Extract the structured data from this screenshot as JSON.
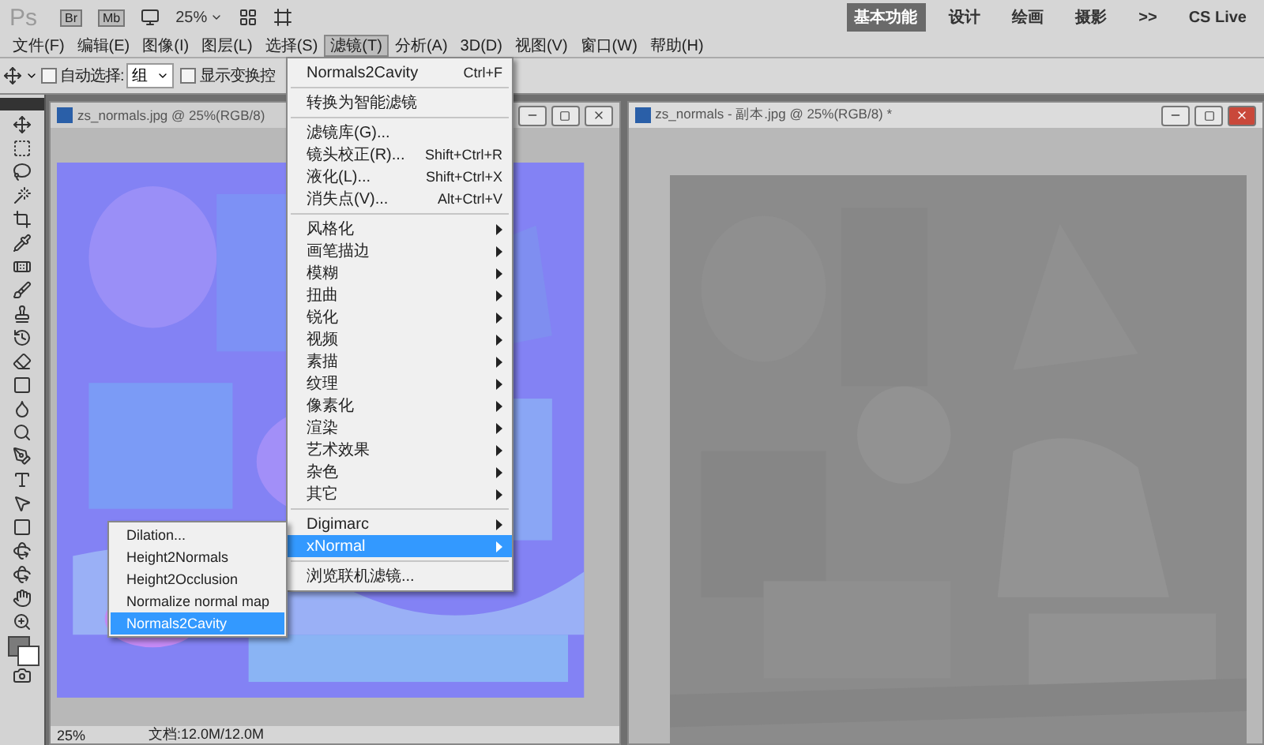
{
  "app_bar": {
    "logo": "Ps",
    "buttons": [
      "Br",
      "Mb"
    ],
    "zoom": "25%",
    "workspaces": [
      {
        "label": "基本功能",
        "selected": true
      },
      {
        "label": "设计",
        "selected": false
      },
      {
        "label": "绘画",
        "selected": false
      },
      {
        "label": "摄影",
        "selected": false
      }
    ],
    "more": ">>",
    "cs_live": "CS Live"
  },
  "menu_bar": [
    {
      "label": "文件(F)",
      "selected": false
    },
    {
      "label": "编辑(E)",
      "selected": false
    },
    {
      "label": "图像(I)",
      "selected": false
    },
    {
      "label": "图层(L)",
      "selected": false
    },
    {
      "label": "选择(S)",
      "selected": false
    },
    {
      "label": "滤镜(T)",
      "selected": true
    },
    {
      "label": "分析(A)",
      "selected": false
    },
    {
      "label": "3D(D)",
      "selected": false
    },
    {
      "label": "视图(V)",
      "selected": false
    },
    {
      "label": "窗口(W)",
      "selected": false
    },
    {
      "label": "帮助(H)",
      "selected": false
    }
  ],
  "options_bar": {
    "auto_select": {
      "label": "自动选择:",
      "checked": false
    },
    "auto_select_value": "组",
    "show_transform": {
      "label": "显示变换控",
      "checked": false
    }
  },
  "filter_menu": [
    {
      "kind": "item",
      "label": "Normals2Cavity",
      "shortcut": "Ctrl+F",
      "submenu": false,
      "selected": false
    },
    {
      "kind": "separator"
    },
    {
      "kind": "item",
      "label": "转换为智能滤镜",
      "submenu": false,
      "selected": false
    },
    {
      "kind": "separator"
    },
    {
      "kind": "item",
      "label": "滤镜库(G)...",
      "submenu": false,
      "selected": false
    },
    {
      "kind": "item",
      "label": "镜头校正(R)...",
      "shortcut": "Shift+Ctrl+R",
      "submenu": false,
      "selected": false
    },
    {
      "kind": "item",
      "label": "液化(L)...",
      "shortcut": "Shift+Ctrl+X",
      "submenu": false,
      "selected": false
    },
    {
      "kind": "item",
      "label": "消失点(V)...",
      "shortcut": "Alt+Ctrl+V",
      "submenu": false,
      "selected": false
    },
    {
      "kind": "separator"
    },
    {
      "kind": "item",
      "label": "风格化",
      "submenu": true,
      "selected": false
    },
    {
      "kind": "item",
      "label": "画笔描边",
      "submenu": true,
      "selected": false
    },
    {
      "kind": "item",
      "label": "模糊",
      "submenu": true,
      "selected": false
    },
    {
      "kind": "item",
      "label": "扭曲",
      "submenu": true,
      "selected": false
    },
    {
      "kind": "item",
      "label": "锐化",
      "submenu": true,
      "selected": false
    },
    {
      "kind": "item",
      "label": "视频",
      "submenu": true,
      "selected": false
    },
    {
      "kind": "item",
      "label": "素描",
      "submenu": true,
      "selected": false
    },
    {
      "kind": "item",
      "label": "纹理",
      "submenu": true,
      "selected": false
    },
    {
      "kind": "item",
      "label": "像素化",
      "submenu": true,
      "selected": false
    },
    {
      "kind": "item",
      "label": "渲染",
      "submenu": true,
      "selected": false
    },
    {
      "kind": "item",
      "label": "艺术效果",
      "submenu": true,
      "selected": false
    },
    {
      "kind": "item",
      "label": "杂色",
      "submenu": true,
      "selected": false
    },
    {
      "kind": "item",
      "label": "其它",
      "submenu": true,
      "selected": false
    },
    {
      "kind": "separator"
    },
    {
      "kind": "item",
      "label": "Digimarc",
      "submenu": true,
      "selected": false
    },
    {
      "kind": "item",
      "label": "xNormal",
      "submenu": true,
      "selected": true
    },
    {
      "kind": "separator"
    },
    {
      "kind": "item",
      "label": "浏览联机滤镜...",
      "submenu": false,
      "selected": false
    }
  ],
  "xnormal_submenu": [
    {
      "label": "Dilation...",
      "selected": false
    },
    {
      "label": "Height2Normals",
      "selected": false
    },
    {
      "label": "Height2Occlusion",
      "selected": false
    },
    {
      "label": "Normalize normal map",
      "selected": false
    },
    {
      "label": "Normals2Cavity",
      "selected": true
    }
  ],
  "documents": [
    {
      "title": "zs_normals.jpg @ 25%(RGB/8)",
      "active": false
    },
    {
      "title": "zs_normals - 副本.jpg @ 25%(RGB/8) *",
      "active": true
    }
  ],
  "status_bar": {
    "zoom": "25%",
    "doc_size": "文档:12.0M/12.0M"
  }
}
